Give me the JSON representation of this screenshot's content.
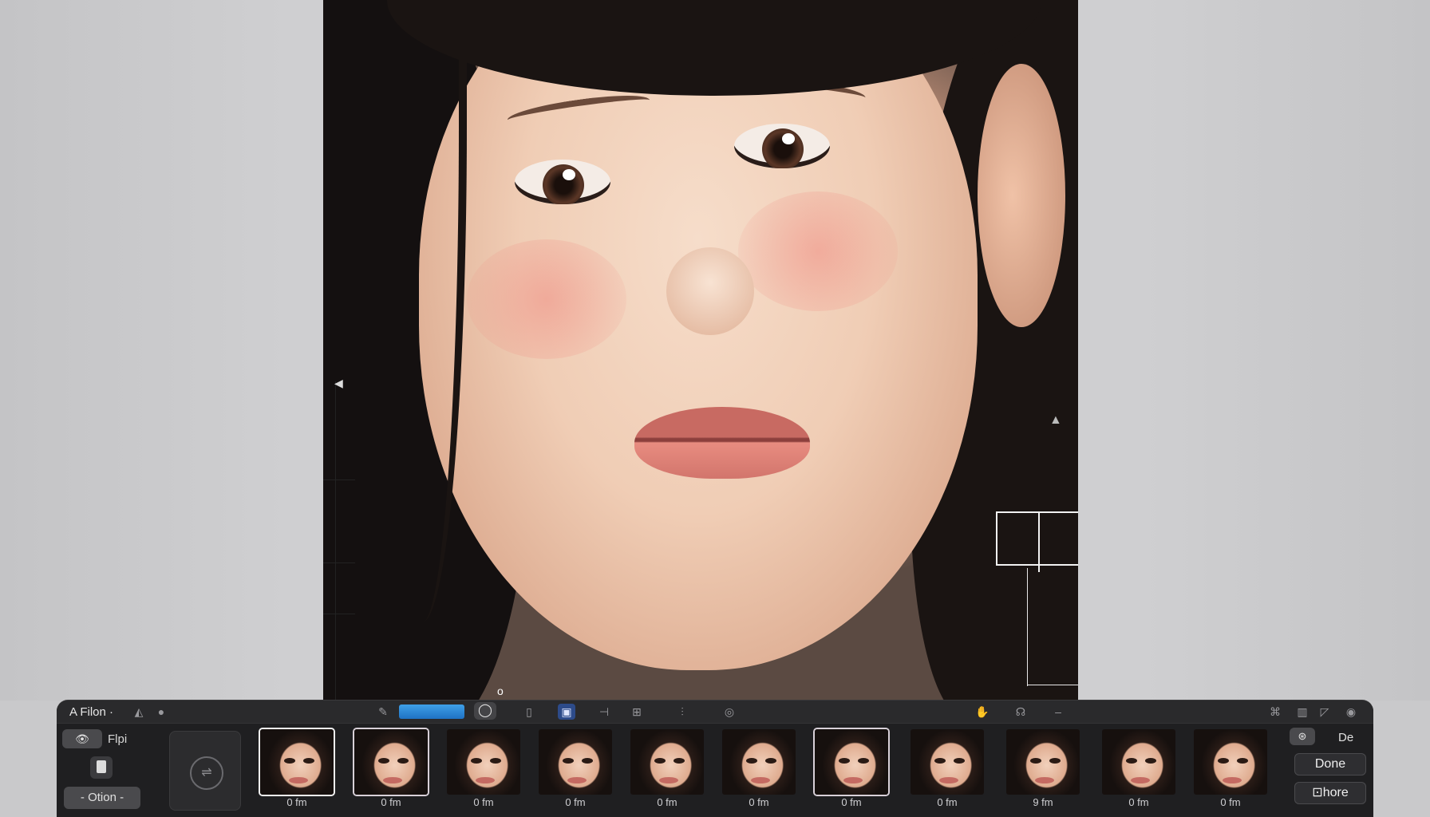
{
  "toolbar": {
    "title": "A Filon ·",
    "icons": [
      "triangle-icon",
      "dot-icon",
      "pen-icon",
      "blue-slider",
      "circle-icon",
      "page-icon",
      "frame-icon",
      "split-icon",
      "adjust-icon",
      "level-icon",
      "wheel-icon",
      "hands-icon",
      "wave-icon",
      "minus-icon",
      "share-icon",
      "columns-icon",
      "corner-icon",
      "camera-icon"
    ]
  },
  "left": {
    "eye_button": "👁",
    "flip_label": "Flpi",
    "option_button": "- Otion -"
  },
  "canvas": {
    "marker_o": "o"
  },
  "thumbnails": {
    "captions": [
      "0 fm",
      "0 fm",
      "0 fm",
      "0 fm",
      "0 fm",
      "0 fm",
      "0 fm",
      "0 fm",
      "9 fm",
      "0 fm",
      "0 fm"
    ]
  },
  "right": {
    "small_button": "⊛",
    "de_label": "De",
    "done_button": "Done",
    "more_button": "⊡hore"
  },
  "colors": {
    "panel": "#1f1f21",
    "accent_blue": "#2a86d6",
    "background": "#cfcfd1"
  }
}
